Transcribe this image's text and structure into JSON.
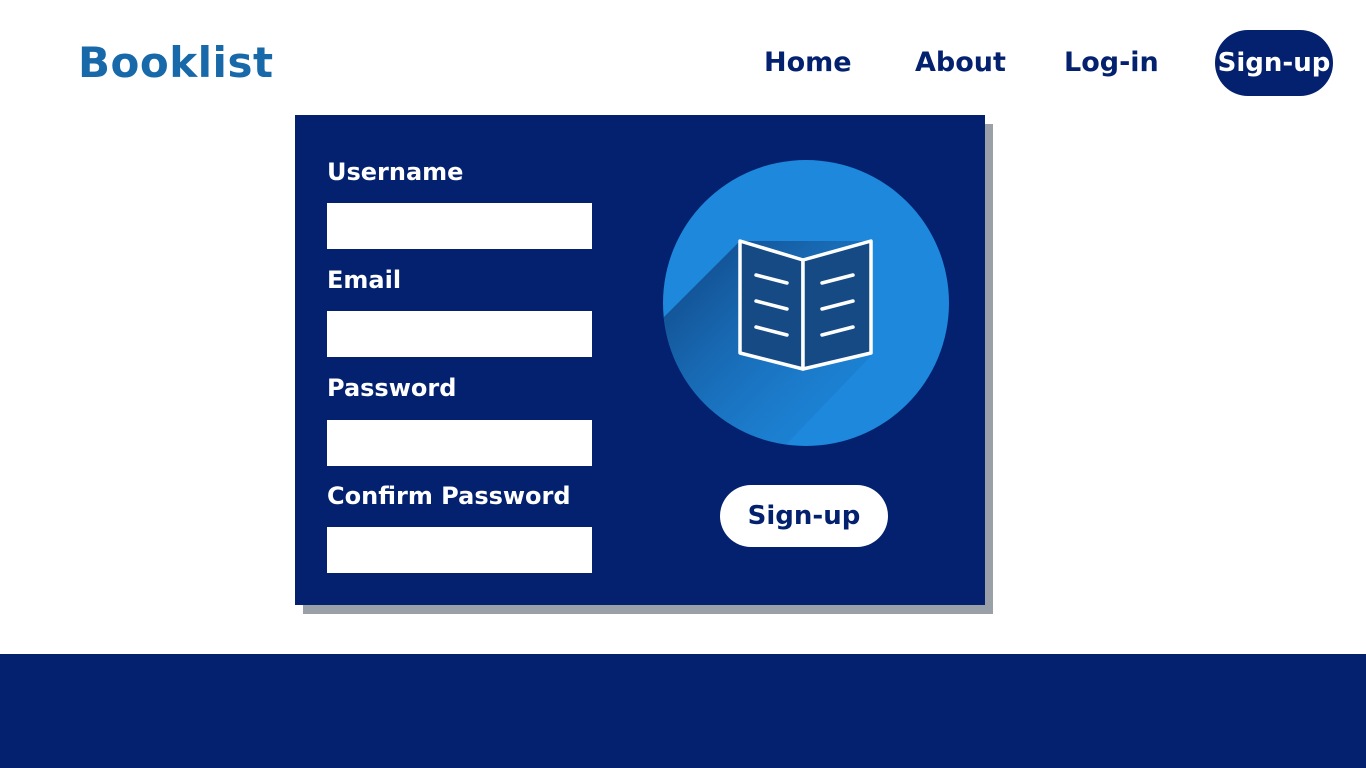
{
  "header": {
    "brand": "Booklist",
    "nav": {
      "home": "Home",
      "about": "About",
      "login": "Log-in",
      "signup": "Sign-up"
    }
  },
  "form": {
    "username_label": "Username",
    "username_value": "",
    "email_label": "Email",
    "email_value": "",
    "password_label": "Password",
    "password_value": "",
    "confirm_label": "Confirm Password",
    "confirm_value": "",
    "submit_label": "Sign-up",
    "logo_icon": "open-book-icon"
  },
  "colors": {
    "brand": "#1769aa",
    "navy": "#03216f",
    "circle": "#1e88dc",
    "white": "#ffffff"
  }
}
